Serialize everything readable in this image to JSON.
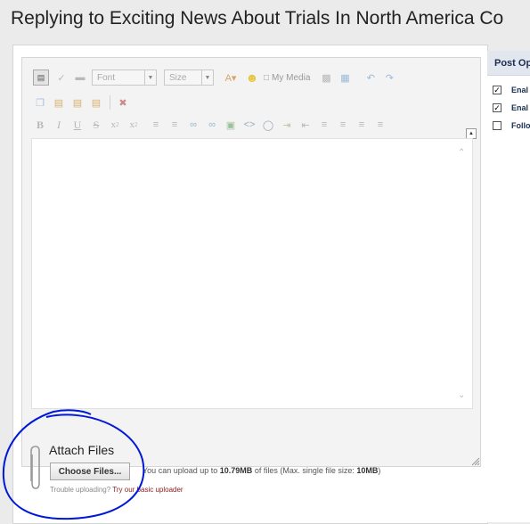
{
  "title": "Replying to Exciting News About Trials In North America Co",
  "toolbar": {
    "font_select": "Font",
    "size_select": "Size",
    "my_media_label": "My Media",
    "row1_icons": [
      "source-icon",
      "eraser-icon",
      "horizontal-rule-icon"
    ],
    "row1b_icons": [
      "text-color-icon",
      "smiley-icon",
      "my-media-icon"
    ],
    "row1c_icons": [
      "spellcheck-icon",
      "find-replace-icon",
      "undo-icon",
      "redo-icon"
    ],
    "row2_icons": [
      "copy-icon",
      "paste-icon",
      "paste-text-icon",
      "paste-word-icon",
      "remove-format-icon"
    ],
    "row3": {
      "bold": "B",
      "italic": "I",
      "underline": "U",
      "strike": "S",
      "subscript": "x",
      "superscript": "x"
    },
    "row3_icons": [
      "bulleted-list-icon",
      "numbered-list-icon",
      "link-icon",
      "unlink-icon",
      "image-icon",
      "code-icon",
      "quote-icon",
      "indent-icon",
      "outdent-icon",
      "align-left-icon",
      "align-center-icon",
      "align-right-icon",
      "justify-icon"
    ]
  },
  "attach": {
    "title": "Attach Files",
    "choose_button": "Choose Files...",
    "upload_prefix": "You can upload up to",
    "upload_size": "10.79MB",
    "upload_middle": "of files (Max. single file size:",
    "single_size": "10MB",
    "upload_suffix": ")",
    "trouble_text": "Trouble uploading?",
    "basic_link": "Try our basic uploader"
  },
  "post_options": {
    "header": "Post Op",
    "options": [
      {
        "label": "Enal",
        "checked": true
      },
      {
        "label": "Enal",
        "checked": true
      },
      {
        "label": "Follo",
        "checked": false
      }
    ]
  },
  "colors": {
    "annotation_circle": "#0018d8",
    "link": "#8b1a1a",
    "post_header_text": "#1c2d52"
  }
}
